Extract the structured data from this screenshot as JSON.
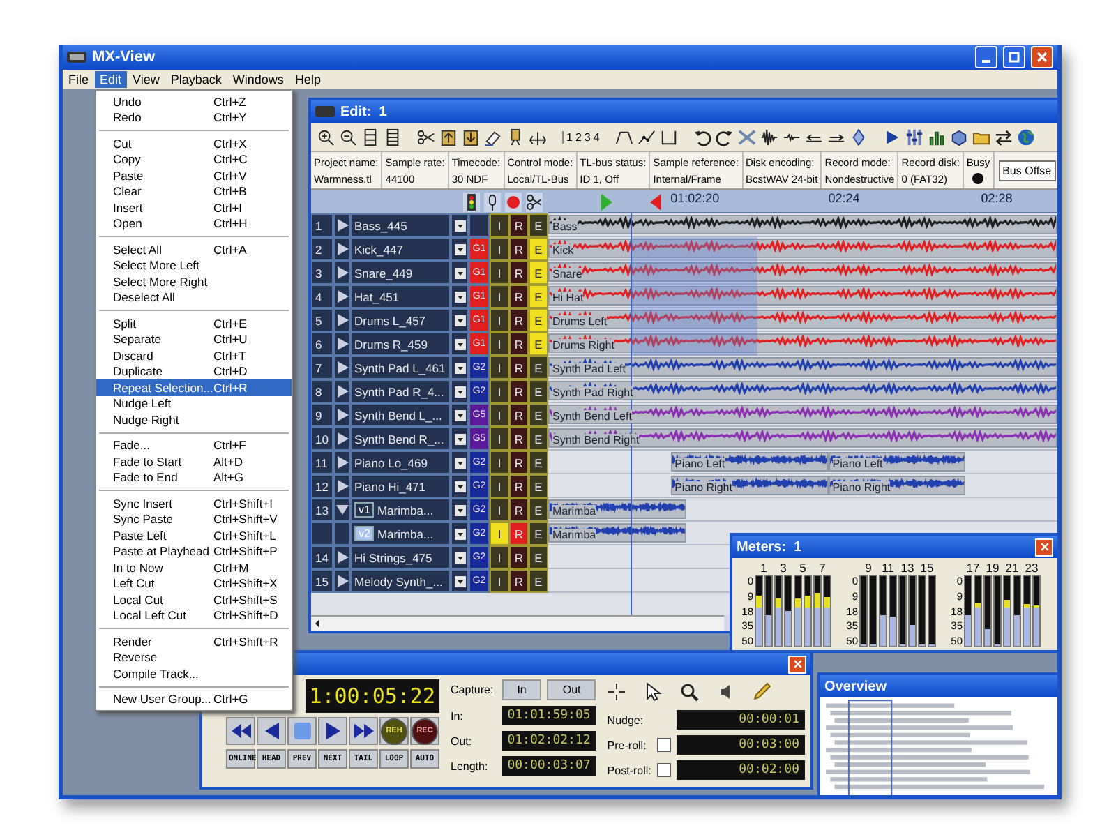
{
  "app": {
    "title": "MX-View"
  },
  "menubar": [
    {
      "label": "File",
      "selected": false
    },
    {
      "label": "Edit",
      "selected": true
    },
    {
      "label": "View",
      "selected": false
    },
    {
      "label": "Playback",
      "selected": false
    },
    {
      "label": "Windows",
      "selected": false
    },
    {
      "label": "Help",
      "selected": false
    }
  ],
  "edit_menu": {
    "groups": [
      [
        {
          "label": "Undo",
          "shortcut": "Ctrl+Z",
          "selected": false
        },
        {
          "label": "Redo",
          "shortcut": "Ctrl+Y",
          "selected": false
        }
      ],
      [
        {
          "label": "Cut",
          "shortcut": "Ctrl+X",
          "selected": false
        },
        {
          "label": "Copy",
          "shortcut": "Ctrl+C",
          "selected": false
        },
        {
          "label": "Paste",
          "shortcut": "Ctrl+V",
          "selected": false
        },
        {
          "label": "Clear",
          "shortcut": "Ctrl+B",
          "selected": false
        },
        {
          "label": "Insert",
          "shortcut": "Ctrl+I",
          "selected": false
        },
        {
          "label": "Open",
          "shortcut": "Ctrl+H",
          "selected": false
        }
      ],
      [
        {
          "label": "Select All",
          "shortcut": "Ctrl+A",
          "selected": false
        },
        {
          "label": "Select More Left",
          "selected": false
        },
        {
          "label": "Select More Right",
          "selected": false
        },
        {
          "label": "Deselect All",
          "selected": false
        }
      ],
      [
        {
          "label": "Split",
          "shortcut": "Ctrl+E",
          "selected": false
        },
        {
          "label": "Separate",
          "shortcut": "Ctrl+U",
          "selected": false
        },
        {
          "label": "Discard",
          "shortcut": "Ctrl+T",
          "selected": false
        },
        {
          "label": "Duplicate",
          "shortcut": "Ctrl+D",
          "selected": false
        },
        {
          "label": "Repeat Selection...",
          "shortcut": "Ctrl+R",
          "selected": true
        },
        {
          "label": "Nudge Left",
          "selected": false
        },
        {
          "label": "Nudge Right",
          "selected": false
        }
      ],
      [
        {
          "label": "Fade...",
          "shortcut": "Ctrl+F",
          "selected": false
        },
        {
          "label": "Fade to Start",
          "shortcut": "Alt+D",
          "selected": false
        },
        {
          "label": "Fade to End",
          "shortcut": "Alt+G",
          "selected": false
        }
      ],
      [
        {
          "label": "Sync Insert",
          "shortcut": "Ctrl+Shift+I",
          "selected": false
        },
        {
          "label": "Sync Paste",
          "shortcut": "Ctrl+Shift+V",
          "selected": false
        },
        {
          "label": "Paste Left",
          "shortcut": "Ctrl+Shift+L",
          "selected": false
        },
        {
          "label": "Paste at Playhead",
          "shortcut": "Ctrl+Shift+P",
          "selected": false
        },
        {
          "label": "In to Now",
          "shortcut": "Ctrl+M",
          "selected": false
        },
        {
          "label": "Left Cut",
          "shortcut": "Ctrl+Shift+X",
          "selected": false
        },
        {
          "label": "Local Cut",
          "shortcut": "Ctrl+Shift+S",
          "selected": false
        },
        {
          "label": "Local Left Cut",
          "shortcut": "Ctrl+Shift+D",
          "selected": false
        }
      ],
      [
        {
          "label": "Render",
          "shortcut": "Ctrl+Shift+R",
          "selected": false
        },
        {
          "label": "Reverse",
          "selected": false
        },
        {
          "label": "Compile Track...",
          "selected": false
        }
      ],
      [
        {
          "label": "New User Group...",
          "shortcut": "Ctrl+G",
          "selected": false
        }
      ]
    ]
  },
  "edit_window": {
    "title": "Edit:  1",
    "toolbar_numbers": [
      "1",
      "2",
      "3",
      "4"
    ],
    "info": [
      {
        "label": "Project name:",
        "value": "Warmness.tl"
      },
      {
        "label": "Sample rate:",
        "value": "44100"
      },
      {
        "label": "Timecode:",
        "value": "30 NDF"
      },
      {
        "label": "Control mode:",
        "value": "Local/TL-Bus"
      },
      {
        "label": "TL-bus status:",
        "value": "ID 1, Off"
      },
      {
        "label": "Sample reference:",
        "value": "Internal/Frame"
      },
      {
        "label": "Disk encoding:",
        "value": "BcstWAV 24-bit"
      },
      {
        "label": "Record mode:",
        "value": "Nondestructive"
      },
      {
        "label": "Record disk:",
        "value": "0 (FAT32)"
      }
    ],
    "busy": {
      "label": "Busy"
    },
    "bus_offset": {
      "value": "Bus Offse"
    },
    "ruler": [
      "01:02:20",
      "02:24",
      "02:28"
    ],
    "tracks": [
      {
        "kind": "track",
        "number": "1",
        "expanded": false,
        "name": "Bass_445",
        "buttons": [
          {
            "label": "I",
            "on": false
          },
          {
            "label": "R",
            "on": false
          },
          {
            "label": "E",
            "on": false
          }
        ],
        "clips": [
          {
            "label": "Bass",
            "color": "#202020"
          }
        ]
      },
      {
        "kind": "track",
        "number": "2",
        "expanded": false,
        "name": "Kick_447",
        "group": {
          "label": "G1",
          "color": "#e02020"
        },
        "buttons": [
          {
            "label": "I",
            "on": false
          },
          {
            "label": "R",
            "on": false
          },
          {
            "label": "E",
            "on": true
          }
        ],
        "clips": [
          {
            "label": "Kick",
            "color": "#e02020"
          }
        ]
      },
      {
        "kind": "track",
        "number": "3",
        "expanded": false,
        "name": "Snare_449",
        "group": {
          "label": "G1",
          "color": "#e02020"
        },
        "buttons": [
          {
            "label": "I",
            "on": false
          },
          {
            "label": "R",
            "on": false
          },
          {
            "label": "E",
            "on": true
          }
        ],
        "clips": [
          {
            "label": "Snare",
            "color": "#e02020"
          }
        ]
      },
      {
        "kind": "track",
        "number": "4",
        "expanded": false,
        "name": "Hat_451",
        "group": {
          "label": "G1",
          "color": "#e02020"
        },
        "buttons": [
          {
            "label": "I",
            "on": false
          },
          {
            "label": "R",
            "on": false
          },
          {
            "label": "E",
            "on": true
          }
        ],
        "clips": [
          {
            "label": "Hi Hat",
            "color": "#e02020"
          }
        ]
      },
      {
        "kind": "track",
        "number": "5",
        "expanded": false,
        "name": "Drums L_457",
        "group": {
          "label": "G1",
          "color": "#e02020"
        },
        "buttons": [
          {
            "label": "I",
            "on": false
          },
          {
            "label": "R",
            "on": false
          },
          {
            "label": "E",
            "on": true
          }
        ],
        "clips": [
          {
            "label": "Drums Left",
            "color": "#e02020"
          }
        ]
      },
      {
        "kind": "track",
        "number": "6",
        "expanded": false,
        "name": "Drums R_459",
        "group": {
          "label": "G1",
          "color": "#e02020"
        },
        "buttons": [
          {
            "label": "I",
            "on": false
          },
          {
            "label": "R",
            "on": false
          },
          {
            "label": "E",
            "on": true
          }
        ],
        "clips": [
          {
            "label": "Drums Right",
            "color": "#e02020"
          }
        ]
      },
      {
        "kind": "track",
        "number": "7",
        "expanded": false,
        "name": "Synth Pad L_461",
        "group": {
          "label": "G2",
          "color": "#1a2a9a"
        },
        "buttons": [
          {
            "label": "I",
            "on": false
          },
          {
            "label": "R",
            "on": false
          },
          {
            "label": "E",
            "on": false
          }
        ],
        "clips": [
          {
            "label": "Synth Pad Left",
            "color": "#2040b0"
          }
        ]
      },
      {
        "kind": "track",
        "number": "8",
        "expanded": false,
        "name": "Synth Pad R_4...",
        "group": {
          "label": "G2",
          "color": "#1a2a9a"
        },
        "buttons": [
          {
            "label": "I",
            "on": false
          },
          {
            "label": "R",
            "on": false
          },
          {
            "label": "E",
            "on": false
          }
        ],
        "clips": [
          {
            "label": "Synth Pad Right",
            "color": "#2040b0"
          }
        ]
      },
      {
        "kind": "track",
        "number": "9",
        "expanded": false,
        "name": "Synth Bend L_...",
        "group": {
          "label": "G5",
          "color": "#5a1a9a"
        },
        "buttons": [
          {
            "label": "I",
            "on": false
          },
          {
            "label": "R",
            "on": false
          },
          {
            "label": "E",
            "on": false
          }
        ],
        "clips": [
          {
            "label": "Synth Bend Left",
            "color": "#8a30b0"
          }
        ]
      },
      {
        "kind": "track",
        "number": "10",
        "expanded": false,
        "name": "Synth Bend R_...",
        "group": {
          "label": "G5",
          "color": "#5a1a9a"
        },
        "buttons": [
          {
            "label": "I",
            "on": false
          },
          {
            "label": "R",
            "on": false
          },
          {
            "label": "E",
            "on": false
          }
        ],
        "clips": [
          {
            "label": "Synth Bend Right",
            "color": "#8a30b0"
          }
        ]
      },
      {
        "kind": "track",
        "number": "11",
        "expanded": false,
        "name": "Piano Lo_469",
        "group": {
          "label": "G2",
          "color": "#1a2a9a"
        },
        "buttons": [
          {
            "label": "I",
            "on": false
          },
          {
            "label": "R",
            "on": false
          },
          {
            "label": "E",
            "on": false
          }
        ],
        "clips": [
          {
            "label": "Piano Left",
            "color": "#2040b0"
          },
          {
            "label": "Piano Left",
            "color": "#2040b0"
          }
        ]
      },
      {
        "kind": "track",
        "number": "12",
        "expanded": false,
        "name": "Piano Hi_471",
        "group": {
          "label": "G2",
          "color": "#1a2a9a"
        },
        "buttons": [
          {
            "label": "I",
            "on": false
          },
          {
            "label": "R",
            "on": false
          },
          {
            "label": "E",
            "on": false
          }
        ],
        "clips": [
          {
            "label": "Piano Right",
            "color": "#2040b0"
          },
          {
            "label": "Piano Right",
            "color": "#2040b0"
          }
        ]
      },
      {
        "kind": "track",
        "number": "13",
        "expanded": true,
        "version": {
          "label": "v1",
          "selected": false
        },
        "name": "Marimba...",
        "group": {
          "label": "G2",
          "color": "#1a2a9a"
        },
        "buttons": [
          {
            "label": "I",
            "on": false
          },
          {
            "label": "R",
            "on": false
          },
          {
            "label": "E",
            "on": false
          }
        ],
        "clips": [
          {
            "label": "Marimba",
            "color": "#2040b0"
          }
        ]
      },
      {
        "kind": "version",
        "version": {
          "label": "v2",
          "selected": true
        },
        "name": "Marimba...",
        "group": {
          "label": "G2",
          "color": "#1a2a9a"
        },
        "buttons": [
          {
            "label": "I",
            "on": true
          },
          {
            "label": "R",
            "on": true
          },
          {
            "label": "E",
            "on": false
          }
        ],
        "clips": [
          {
            "label": "Marimba",
            "color": "#2040b0"
          }
        ]
      },
      {
        "kind": "track",
        "number": "14",
        "expanded": false,
        "name": "Hi Strings_475",
        "group": {
          "label": "G2",
          "color": "#1a2a9a"
        },
        "buttons": [
          {
            "label": "I",
            "on": false
          },
          {
            "label": "R",
            "on": false
          },
          {
            "label": "E",
            "on": false
          }
        ]
      },
      {
        "kind": "track",
        "number": "15",
        "expanded": false,
        "name": "Melody Synth_...",
        "group": {
          "label": "G2",
          "color": "#1a2a9a"
        },
        "buttons": [
          {
            "label": "I",
            "on": false
          },
          {
            "label": "R",
            "on": false
          },
          {
            "label": "E",
            "on": false
          }
        ]
      }
    ]
  },
  "meters": {
    "title": "Meters:  1",
    "groups": [
      {
        "labels": [
          "1",
          "3",
          "5",
          "7"
        ],
        "scale": [
          "0",
          "9",
          "18",
          "35",
          "50"
        ],
        "channels": [
          {
            "level": 0.72
          },
          {
            "level": 0.45
          },
          {
            "level": 0.68
          },
          {
            "level": 0.5
          },
          {
            "level": 0.68
          },
          {
            "level": 0.72
          },
          {
            "level": 0.76
          },
          {
            "level": 0.7
          }
        ]
      },
      {
        "labels": [
          "9",
          "11",
          "13",
          "15"
        ],
        "scale": [
          "0",
          "9",
          "18",
          "35",
          "50"
        ],
        "channels": [
          {
            "level": 0
          },
          {
            "level": 0
          },
          {
            "level": 0.45
          },
          {
            "level": 0.42
          },
          {
            "level": 0
          },
          {
            "level": 0.3
          },
          {
            "level": 0
          },
          {
            "level": 0
          }
        ]
      },
      {
        "labels": [
          "17",
          "19",
          "21",
          "23"
        ],
        "scale": [
          "0",
          "9",
          "18",
          "35",
          "50"
        ],
        "channels": [
          {
            "level": 0.45
          },
          {
            "level": 0.62
          },
          {
            "level": 0.25
          },
          {
            "level": 0
          },
          {
            "level": 0.66
          },
          {
            "level": 0.45
          },
          {
            "level": 0.6
          },
          {
            "level": 0.58
          }
        ]
      }
    ]
  },
  "transport": {
    "timecode": "1:00:05:22",
    "rehearse": "REH",
    "record": "REC",
    "modes": [
      "ONLINE",
      "HEAD",
      "PREV",
      "NEXT",
      "TAIL",
      "LOOP",
      "AUTO"
    ],
    "capture": {
      "label": "Capture:",
      "buttons": [
        "In",
        "Out"
      ]
    },
    "points": [
      {
        "label": "In:",
        "value": "01:01:59:05"
      },
      {
        "label": "Out:",
        "value": "01:02:02:12"
      },
      {
        "label": "Length:",
        "value": "00:00:03:07"
      }
    ],
    "nudge": [
      {
        "label": "Nudge:",
        "value": "00:00:01"
      },
      {
        "label": "Pre-roll:",
        "checked": false,
        "value": "00:03:00"
      },
      {
        "label": "Post-roll:",
        "checked": false,
        "value": "00:02:00"
      }
    ]
  },
  "overview": {
    "title": "Overview"
  }
}
